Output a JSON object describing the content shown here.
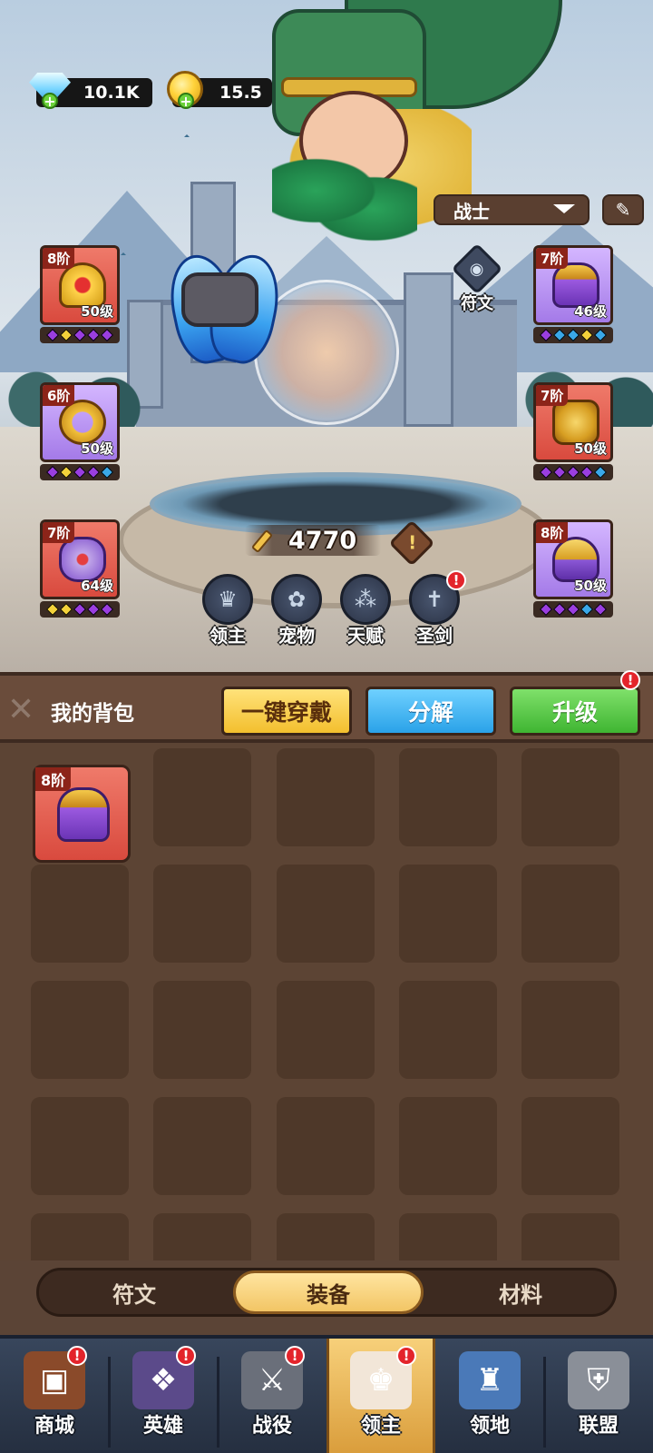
{
  "currency": {
    "gems": "10.1K",
    "gold": "15.5"
  },
  "class_select": {
    "value": "战士"
  },
  "rune_label": "符文",
  "equipment_left": [
    {
      "tier": "8阶",
      "level": "50级",
      "item": "amulet",
      "color": "red",
      "gems": [
        "purple",
        "yellow",
        "purple",
        "purple",
        "purple"
      ]
    },
    {
      "tier": "6阶",
      "level": "50级",
      "item": "ring",
      "color": "purple",
      "gems": [
        "purple",
        "yellow",
        "purple",
        "purple",
        "blue"
      ]
    },
    {
      "tier": "7阶",
      "level": "64级",
      "item": "bracer",
      "color": "red",
      "gems": [
        "yellow",
        "yellow",
        "purple",
        "purple",
        "purple"
      ]
    }
  ],
  "equipment_right": [
    {
      "tier": "7阶",
      "level": "46级",
      "item": "helmet",
      "color": "purple",
      "gems": [
        "purple",
        "blue",
        "blue",
        "yellow",
        "blue"
      ]
    },
    {
      "tier": "7阶",
      "level": "50级",
      "item": "armor",
      "color": "red",
      "gems": [
        "purple",
        "purple",
        "purple",
        "purple",
        "blue"
      ]
    },
    {
      "tier": "8阶",
      "level": "50级",
      "item": "gold-helmet",
      "color": "purple",
      "gems": [
        "purple",
        "purple",
        "purple",
        "blue",
        "purple"
      ]
    }
  ],
  "power": {
    "value": "4770",
    "info_symbol": "!"
  },
  "features": [
    {
      "label": "领主",
      "icon": "crown-shield-icon",
      "alert": false
    },
    {
      "label": "宠物",
      "icon": "paw-icon",
      "alert": false
    },
    {
      "label": "天赋",
      "icon": "talent-nodes-icon",
      "alert": false
    },
    {
      "label": "圣剑",
      "icon": "holy-sword-icon",
      "alert": true
    }
  ],
  "bag": {
    "title": "我的背包",
    "buttons": {
      "equip_all": "一键穿戴",
      "disassemble": "分解",
      "upgrade": "升级"
    },
    "items": [
      {
        "tier": "8阶",
        "item": "helmet",
        "color": "red"
      }
    ]
  },
  "tabs": {
    "runes": "符文",
    "equipment": "装备",
    "materials": "材料",
    "active": "装备"
  },
  "nav": [
    {
      "label": "商城",
      "icon": "chest-icon",
      "alert": true
    },
    {
      "label": "英雄",
      "icon": "hero-cards-icon",
      "alert": true
    },
    {
      "label": "战役",
      "icon": "crossed-swords-icon",
      "alert": true
    },
    {
      "label": "领主",
      "icon": "lord-avatar-icon",
      "alert": true,
      "active": true
    },
    {
      "label": "领地",
      "icon": "castle-icon",
      "alert": false
    },
    {
      "label": "联盟",
      "icon": "knight-helmet-icon",
      "alert": false
    }
  ],
  "alert_symbol": "!",
  "colors": {
    "red_card": "#d94a3e",
    "purple_card": "#a47ae8",
    "equip_btn": "#f3bf2e",
    "split_btn": "#2aa2e8",
    "upgrade_btn": "#3fb532",
    "nav_active": "#f7d07a"
  }
}
